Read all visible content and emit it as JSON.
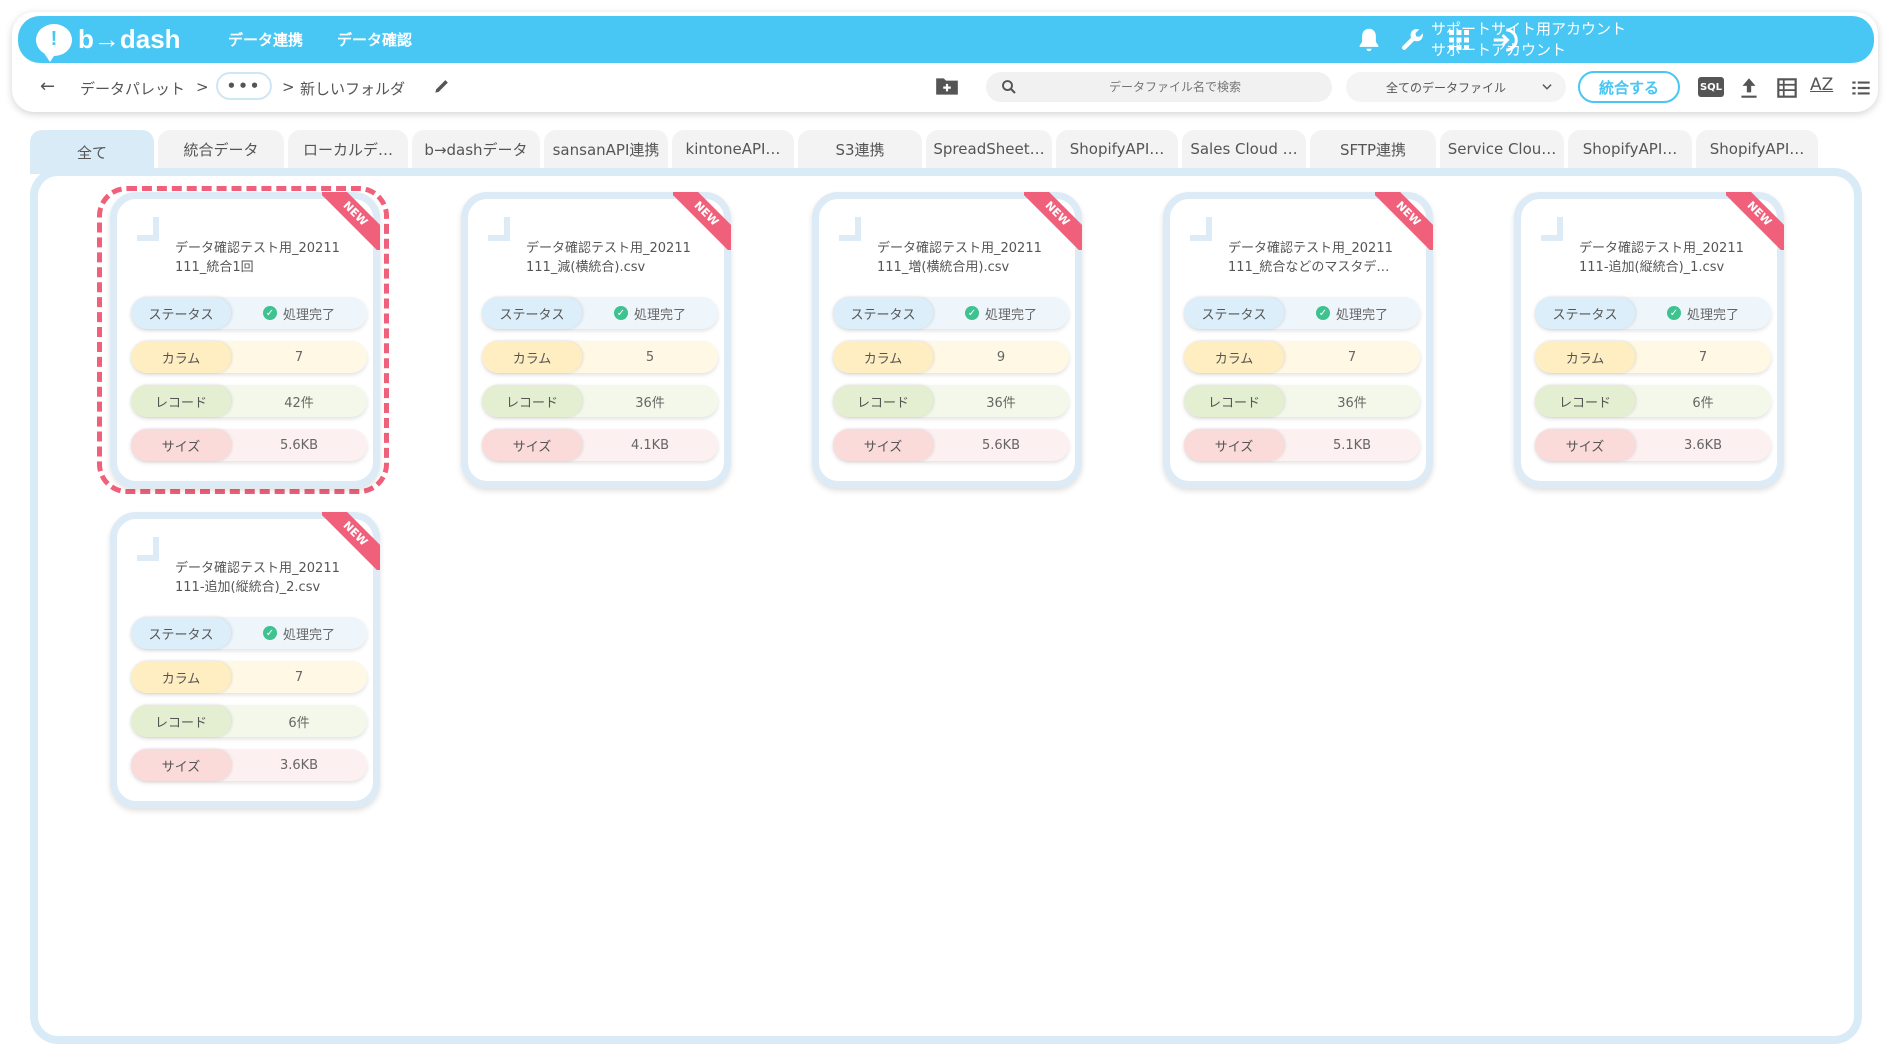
{
  "header": {
    "logo_text": "b→dash",
    "logo_mark": "!",
    "nav": [
      "データ連携",
      "データ確認"
    ],
    "account_line1": "サポートサイト用アカウント",
    "account_line2": "サポートアカウント",
    "icons": [
      "bell-icon",
      "wrench-icon",
      "grid-icon",
      "logout-icon"
    ]
  },
  "toolbar": {
    "back": "←",
    "crumb_root": "データパレット",
    "crumb_sep1": ">",
    "ellipsis": "•••",
    "crumb_sep2": ">",
    "crumb_current": "新しいフォルダ",
    "search_placeholder": "データファイル名で検索",
    "filter_value": "全てのデータファイル",
    "merge_label": "統合する",
    "sql_label": "SQL",
    "az_label": "AZ"
  },
  "tabs": [
    "全て",
    "統合データ",
    "ローカルデ…",
    "b→dashデータ",
    "sansanAPI連携",
    "kintoneAPI…",
    "S3連携",
    "SpreadSheet…",
    "ShopifyAPI…",
    "Sales Cloud …",
    "SFTP連携",
    "Service Clou…",
    "ShopifyAPI…",
    "ShopifyAPI…"
  ],
  "labels": {
    "status": "ステータス",
    "column": "カラム",
    "record": "レコード",
    "size": "サイズ",
    "new": "NEW"
  },
  "cards": [
    {
      "title1": "データ確認テスト用_20211",
      "title2": "111_統合1回",
      "status": "処理完了",
      "columns": "7",
      "records": "42件",
      "size": "5.6KB"
    },
    {
      "title1": "データ確認テスト用_20211",
      "title2": "111_減(横統合).csv",
      "status": "処理完了",
      "columns": "5",
      "records": "36件",
      "size": "4.1KB"
    },
    {
      "title1": "データ確認テスト用_20211",
      "title2": "111_増(横統合用).csv",
      "status": "処理完了",
      "columns": "9",
      "records": "36件",
      "size": "5.6KB"
    },
    {
      "title1": "データ確認テスト用_20211",
      "title2": "111_統合などのマスタデ…",
      "status": "処理完了",
      "columns": "7",
      "records": "36件",
      "size": "5.1KB"
    },
    {
      "title1": "データ確認テスト用_20211",
      "title2": "111-追加(縦統合)_1.csv",
      "status": "処理完了",
      "columns": "7",
      "records": "6件",
      "size": "3.6KB"
    },
    {
      "title1": "データ確認テスト用_20211",
      "title2": "111-追加(縦統合)_2.csv",
      "status": "処理完了",
      "columns": "7",
      "records": "6件",
      "size": "3.6KB"
    }
  ]
}
